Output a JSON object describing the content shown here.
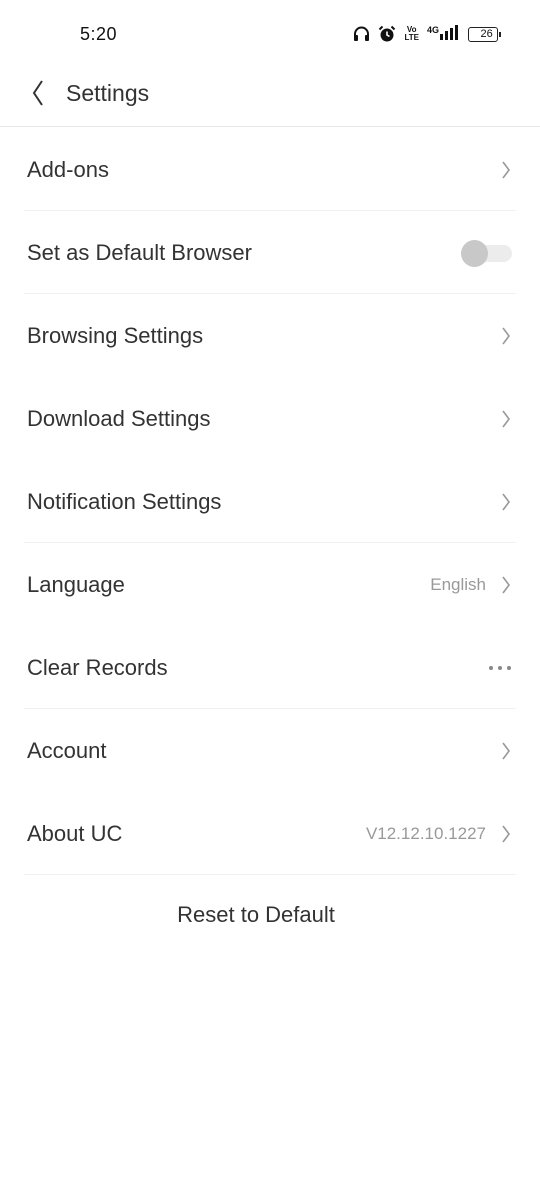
{
  "status_bar": {
    "time": "5:20",
    "icons": [
      "headphones-icon",
      "alarm-icon",
      "volte-icon",
      "4g-signal-icon",
      "battery-icon"
    ],
    "volte_top": "Vo",
    "volte_bottom": "LTE",
    "network": "4G",
    "battery_level": "26"
  },
  "header": {
    "back_icon": "chevron-left-icon",
    "title": "Settings"
  },
  "settings": {
    "items": [
      {
        "label": "Add-ons",
        "accessory": "chevron"
      },
      {
        "label": "Set as Default Browser",
        "accessory": "toggle",
        "toggle_on": false
      },
      {
        "label": "Browsing Settings",
        "accessory": "chevron"
      },
      {
        "label": "Download Settings",
        "accessory": "chevron"
      },
      {
        "label": "Notification Settings",
        "accessory": "chevron"
      },
      {
        "label": "Language",
        "value": "English",
        "accessory": "chevron"
      },
      {
        "label": "Clear Records",
        "accessory": "more-dots"
      },
      {
        "label": "Account",
        "accessory": "chevron"
      },
      {
        "label": "About UC",
        "value": "V12.12.10.1227",
        "accessory": "chevron"
      }
    ]
  },
  "footer": {
    "reset_label": "Reset to Default"
  },
  "colors": {
    "text_primary": "#333333",
    "text_secondary": "#999999",
    "divider": "#f0f0f0",
    "toggle_knob_off": "#c8c8c8",
    "toggle_track_off": "#ececec"
  }
}
